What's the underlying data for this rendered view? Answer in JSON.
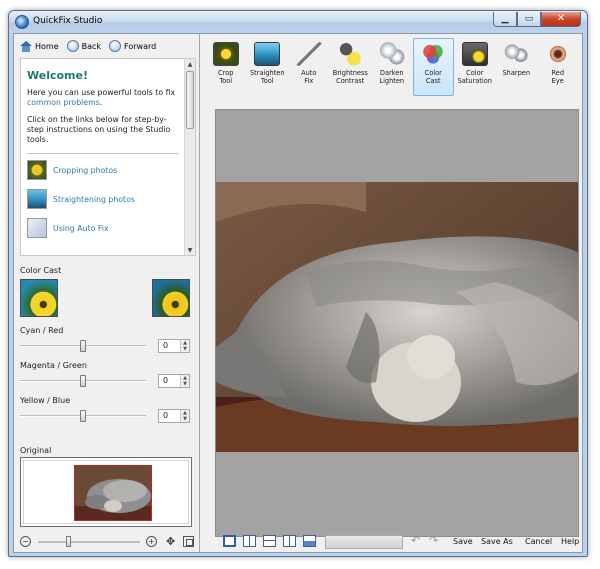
{
  "window": {
    "title": "QuickFix Studio"
  },
  "nav": {
    "home": "Home",
    "back": "Back",
    "forward": "Forward"
  },
  "help": {
    "welcome": "Welcome!",
    "intro_prefix": "Here you can use powerful tools to fix ",
    "intro_link": "common problems",
    "intro_suffix": ".",
    "instructions": "Click on the links below for step-by-step instructions on using the Studio tools.",
    "topics": [
      "Cropping photos",
      "Straightening photos",
      "Using Auto Fix"
    ]
  },
  "color_cast": {
    "label": "Color Cast",
    "sliders": [
      {
        "label": "Cyan / Red",
        "value": "0"
      },
      {
        "label": "Magenta / Green",
        "value": "0"
      },
      {
        "label": "Yellow / Blue",
        "value": "0"
      }
    ]
  },
  "original": {
    "label": "Original"
  },
  "toolbar": {
    "tools": [
      {
        "label": "Crop\nTool",
        "icon": "crop-tool-icon"
      },
      {
        "label": "Straighten\nTool",
        "icon": "straighten-tool-icon"
      },
      {
        "label": "Auto\nFix",
        "icon": "auto-fix-wand-icon"
      },
      {
        "label": "Brightness\nContrast",
        "icon": "brightness-contrast-icon"
      },
      {
        "label": "Darken\nLighten",
        "icon": "darken-lighten-icon"
      },
      {
        "label": "Color\nCast",
        "icon": "color-cast-icon"
      },
      {
        "label": "Color\nSaturation",
        "icon": "color-saturation-icon"
      },
      {
        "label": "Sharpen",
        "icon": "sharpen-icon"
      },
      {
        "label": "Red\nEye",
        "icon": "red-eye-icon"
      }
    ],
    "active_tool": "Color Cast"
  },
  "bottom": {
    "save": "Save",
    "save_as": "Save As",
    "cancel": "Cancel",
    "help": "Help"
  },
  "colors": {
    "accent": "#1f7a6c",
    "link": "#2b79a9",
    "canvas_bg": "#a3a3a3",
    "selection": "#7fb3e0"
  }
}
